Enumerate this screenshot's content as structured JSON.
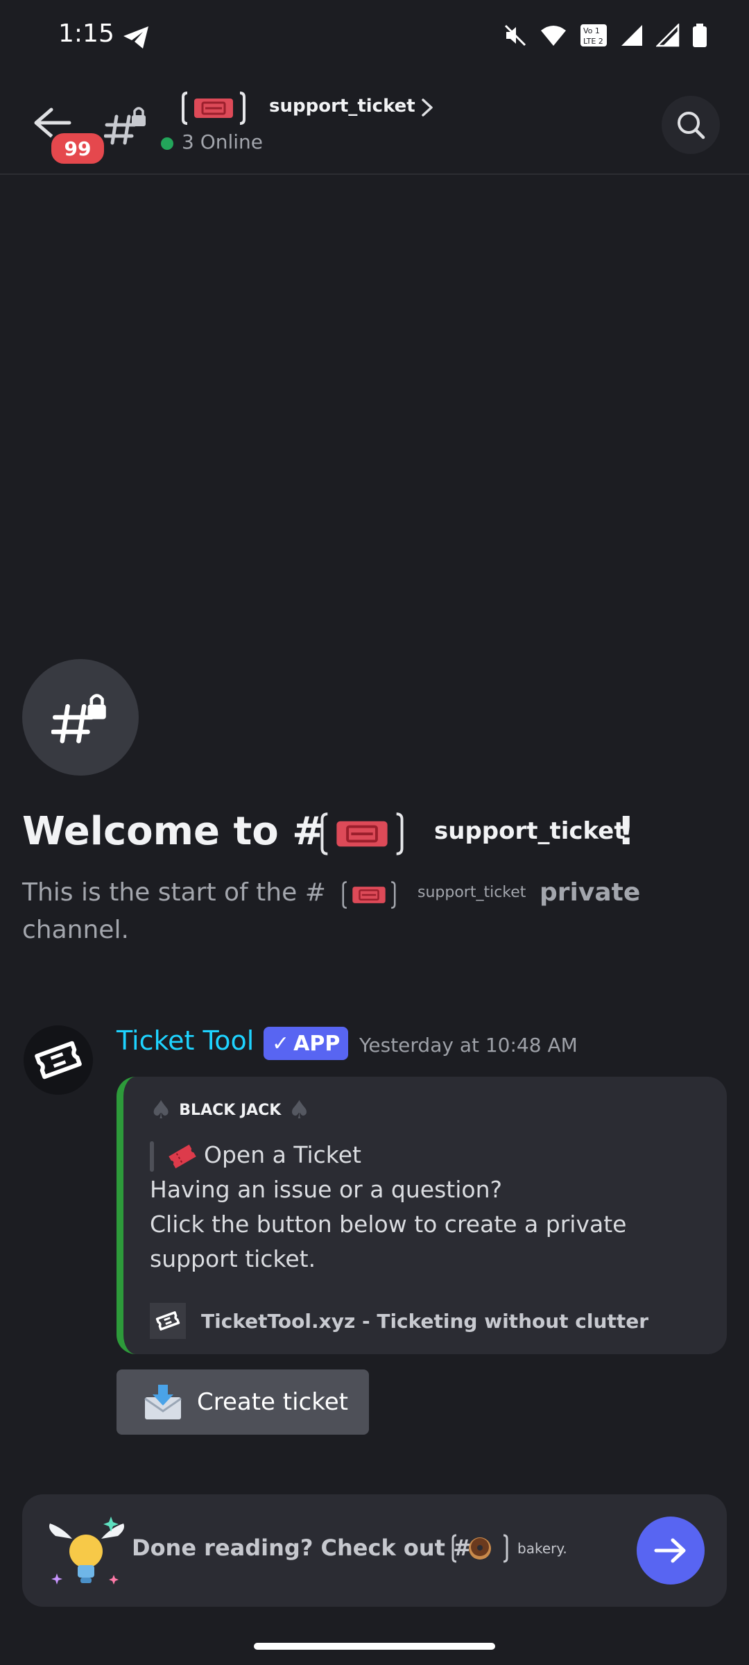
{
  "status_bar": {
    "time": "1:15"
  },
  "header": {
    "unread_badge": "99",
    "channel_name": "support_ticket",
    "online_count": "3 Online"
  },
  "welcome": {
    "title_prefix": "Welcome to #",
    "channel_name": "support_ticket",
    "title_suffix": "!",
    "desc_prefix": "This is the start of the #",
    "desc_channel": "support_ticket",
    "desc_private": "private",
    "desc_line2": "channel."
  },
  "message": {
    "author": "Ticket Tool",
    "app_tag": "APP",
    "timestamp": "Yesterday at 10:48 AM",
    "embed": {
      "author": "BLACK JACK",
      "title": "Open a Ticket",
      "line1": "Having an issue or a question?",
      "line2": "Click the button below to create a private support ticket.",
      "footer": "TicketTool.xyz - Ticketing without clutter",
      "accent_color": "#2d9a3a"
    },
    "button_label": "Create ticket"
  },
  "bottom_prompt": {
    "text": "Done reading? Check out #",
    "channel": "bakery",
    "channel_suffix": "."
  },
  "colors": {
    "background": "#1c1d22",
    "author_color": "#1ed3ff",
    "brand": "#5865f2",
    "badge": "#e5484d",
    "online": "#23a55a"
  }
}
